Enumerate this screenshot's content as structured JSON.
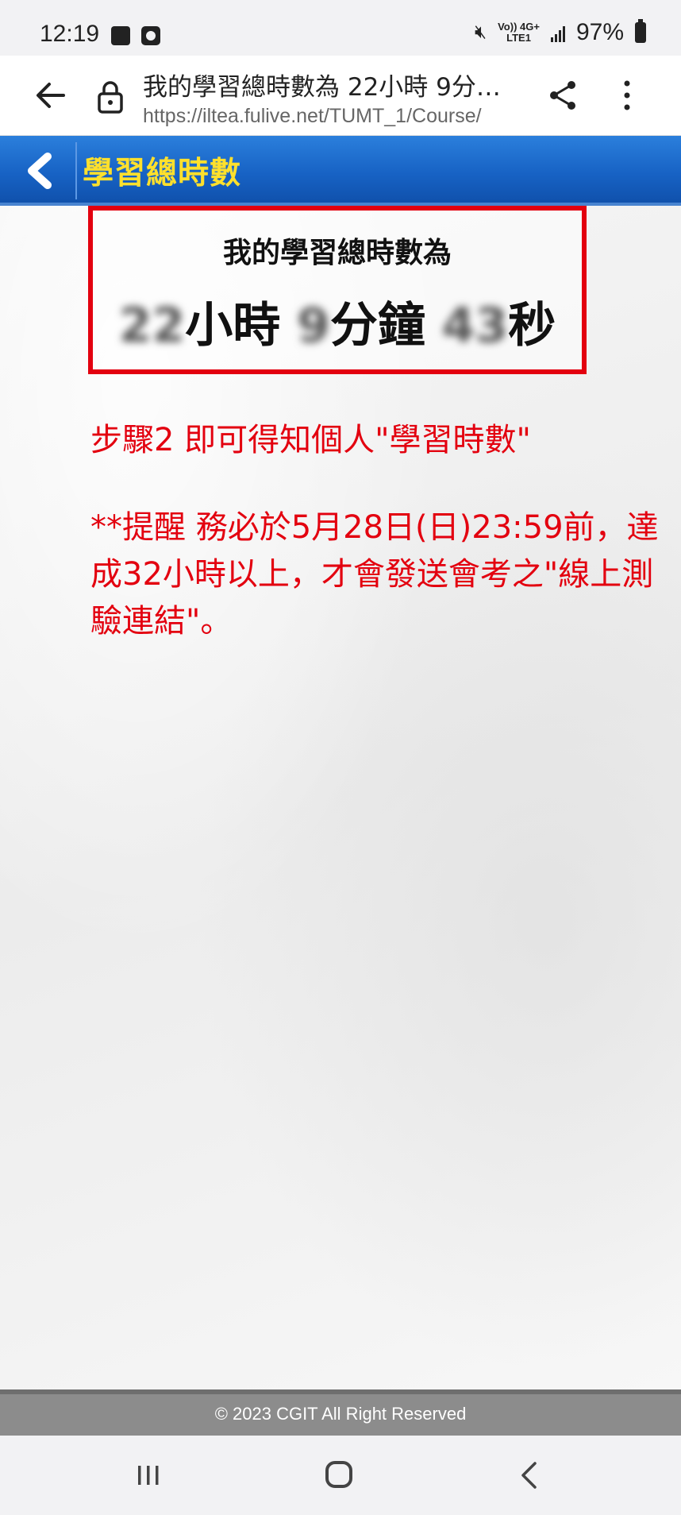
{
  "status_bar": {
    "time": "12:19",
    "network_top": "Vo)) 4G+",
    "network_bottom": "LTE1",
    "battery": "97%",
    "icons": [
      "image-icon",
      "clock-icon",
      "mute-icon",
      "signal-icon",
      "battery-icon"
    ]
  },
  "browser": {
    "page_title": "我的學習總時數為 22小時 9分…",
    "url": "https://iltea.fulive.net/TUMT_1/Course/"
  },
  "app_header": {
    "title": "學習總時數"
  },
  "summary_box": {
    "heading": "我的學習總時數為",
    "hours_value": "22",
    "hours_unit": "小時",
    "minutes_value": "9",
    "minutes_unit": "分鐘",
    "seconds_value": "43",
    "seconds_unit": "秒"
  },
  "instructions": {
    "step2": "步驟2  即可得知個人\"學習時數\"",
    "reminder": "**提醒  務必於5月28日(日)23:59前，達成32小時以上，才會發送會考之\"線上測驗連結\"。"
  },
  "footer": {
    "copyright": "© 2023 CGIT All Right Reserved"
  },
  "colors": {
    "header_blue": "#1762c4",
    "header_title": "#ffe02c",
    "accent_red": "#e3000f"
  }
}
